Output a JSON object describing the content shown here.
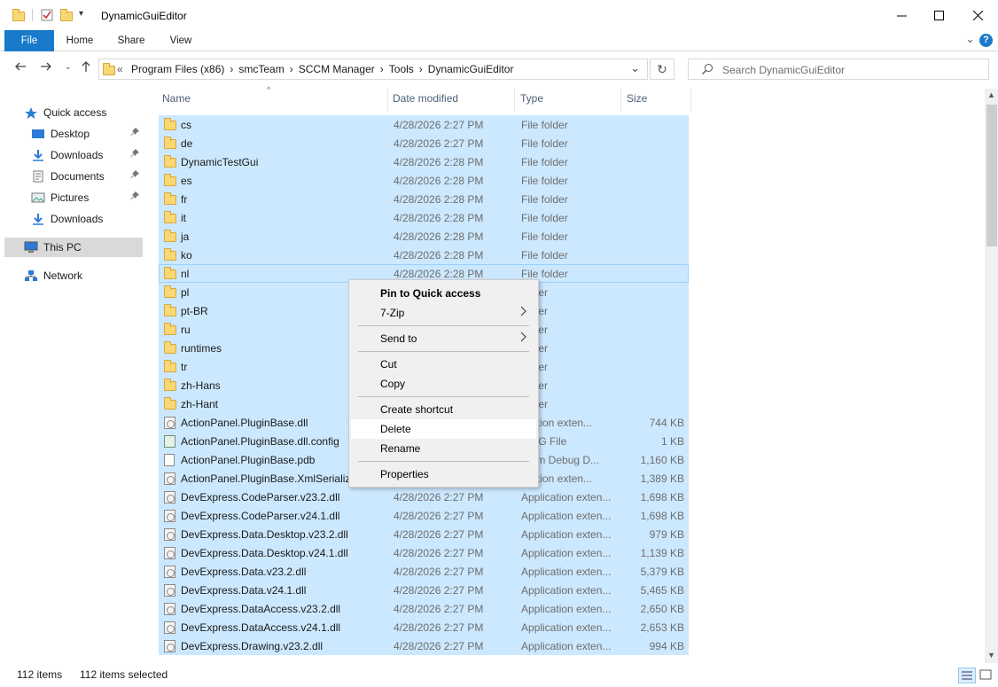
{
  "window": {
    "title": "DynamicGuiEditor",
    "minimize_icon": "minimize-icon",
    "maximize_icon": "maximize-icon",
    "close_icon": "close-icon"
  },
  "ribbon": {
    "tabs": [
      "File",
      "Home",
      "Share",
      "View"
    ],
    "expand_glyph": "⌄",
    "help_glyph": "?"
  },
  "address": {
    "overflow": "«",
    "crumbs": [
      "Program Files (x86)",
      "smcTeam",
      "SCCM Manager",
      "Tools",
      "DynamicGuiEditor"
    ]
  },
  "search": {
    "placeholder": "Search DynamicGuiEditor"
  },
  "nav": {
    "items": [
      {
        "label": "Quick access",
        "icon": "star-icon"
      },
      {
        "label": "Desktop",
        "icon": "desktop-icon",
        "pinned": true
      },
      {
        "label": "Downloads",
        "icon": "download-icon",
        "pinned": true
      },
      {
        "label": "Documents",
        "icon": "documents-icon",
        "pinned": true
      },
      {
        "label": "Pictures",
        "icon": "pictures-icon",
        "pinned": true
      },
      {
        "label": "Downloads",
        "icon": "download-icon",
        "pinned": false
      },
      {
        "label": "This PC",
        "icon": "computer-icon"
      },
      {
        "label": "Network",
        "icon": "network-icon"
      }
    ]
  },
  "columns": {
    "name": "Name",
    "date": "Date modified",
    "type": "Type",
    "size": "Size"
  },
  "files": [
    {
      "name": "cs",
      "date": "4/28/2026 2:27 PM",
      "type": "File folder",
      "size": "",
      "icon": "folder"
    },
    {
      "name": "de",
      "date": "4/28/2026 2:27 PM",
      "type": "File folder",
      "size": "",
      "icon": "folder"
    },
    {
      "name": "DynamicTestGui",
      "date": "4/28/2026 2:28 PM",
      "type": "File folder",
      "size": "",
      "icon": "folder"
    },
    {
      "name": "es",
      "date": "4/28/2026 2:28 PM",
      "type": "File folder",
      "size": "",
      "icon": "folder"
    },
    {
      "name": "fr",
      "date": "4/28/2026 2:28 PM",
      "type": "File folder",
      "size": "",
      "icon": "folder"
    },
    {
      "name": "it",
      "date": "4/28/2026 2:28 PM",
      "type": "File folder",
      "size": "",
      "icon": "folder"
    },
    {
      "name": "ja",
      "date": "4/28/2026 2:28 PM",
      "type": "File folder",
      "size": "",
      "icon": "folder"
    },
    {
      "name": "ko",
      "date": "4/28/2026 2:28 PM",
      "type": "File folder",
      "size": "",
      "icon": "folder"
    },
    {
      "name": "nl",
      "date": "4/28/2026 2:28 PM",
      "type": "File folder",
      "size": "",
      "icon": "folder"
    },
    {
      "name": "pl",
      "date": "",
      "type": "folder",
      "size": "",
      "icon": "folder"
    },
    {
      "name": "pt-BR",
      "date": "",
      "type": "folder",
      "size": "",
      "icon": "folder"
    },
    {
      "name": "ru",
      "date": "",
      "type": "folder",
      "size": "",
      "icon": "folder"
    },
    {
      "name": "runtimes",
      "date": "",
      "type": "folder",
      "size": "",
      "icon": "folder"
    },
    {
      "name": "tr",
      "date": "",
      "type": "folder",
      "size": "",
      "icon": "folder"
    },
    {
      "name": "zh-Hans",
      "date": "",
      "type": "folder",
      "size": "",
      "icon": "folder"
    },
    {
      "name": "zh-Hant",
      "date": "",
      "type": "folder",
      "size": "",
      "icon": "folder"
    },
    {
      "name": "ActionPanel.PluginBase.dll",
      "date": "",
      "type": "lication exten...",
      "size": "744 KB",
      "icon": "dll"
    },
    {
      "name": "ActionPanel.PluginBase.dll.config",
      "date": "",
      "type": "NFIG File",
      "size": "1 KB",
      "icon": "config"
    },
    {
      "name": "ActionPanel.PluginBase.pdb",
      "date": "",
      "type": "gram Debug D...",
      "size": "1,160 KB",
      "icon": "file"
    },
    {
      "name": "ActionPanel.PluginBase.XmlSerialize",
      "date": "",
      "type": "lication exten...",
      "size": "1,389 KB",
      "icon": "dll"
    },
    {
      "name": "DevExpress.CodeParser.v23.2.dll",
      "date": "4/28/2026 2:27 PM",
      "type": "Application exten...",
      "size": "1,698 KB",
      "icon": "dll"
    },
    {
      "name": "DevExpress.CodeParser.v24.1.dll",
      "date": "4/28/2026 2:27 PM",
      "type": "Application exten...",
      "size": "1,698 KB",
      "icon": "dll"
    },
    {
      "name": "DevExpress.Data.Desktop.v23.2.dll",
      "date": "4/28/2026 2:27 PM",
      "type": "Application exten...",
      "size": "979 KB",
      "icon": "dll"
    },
    {
      "name": "DevExpress.Data.Desktop.v24.1.dll",
      "date": "4/28/2026 2:27 PM",
      "type": "Application exten...",
      "size": "1,139 KB",
      "icon": "dll"
    },
    {
      "name": "DevExpress.Data.v23.2.dll",
      "date": "4/28/2026 2:27 PM",
      "type": "Application exten...",
      "size": "5,379 KB",
      "icon": "dll"
    },
    {
      "name": "DevExpress.Data.v24.1.dll",
      "date": "4/28/2026 2:27 PM",
      "type": "Application exten...",
      "size": "5,465 KB",
      "icon": "dll"
    },
    {
      "name": "DevExpress.DataAccess.v23.2.dll",
      "date": "4/28/2026 2:27 PM",
      "type": "Application exten...",
      "size": "2,650 KB",
      "icon": "dll"
    },
    {
      "name": "DevExpress.DataAccess.v24.1.dll",
      "date": "4/28/2026 2:27 PM",
      "type": "Application exten...",
      "size": "2,653 KB",
      "icon": "dll"
    },
    {
      "name": "DevExpress.Drawing.v23.2.dll",
      "date": "4/28/2026 2:27 PM",
      "type": "Application exten...",
      "size": "994 KB",
      "icon": "dll"
    }
  ],
  "context_menu": {
    "items": [
      {
        "label": "Pin to Quick access",
        "bold": true,
        "submenu": false
      },
      {
        "label": "7-Zip",
        "submenu": true
      },
      {
        "sep": true
      },
      {
        "label": "Send to",
        "submenu": true
      },
      {
        "sep": true
      },
      {
        "label": "Cut"
      },
      {
        "label": "Copy"
      },
      {
        "sep": true
      },
      {
        "label": "Create shortcut"
      },
      {
        "label": "Delete",
        "hover": true
      },
      {
        "label": "Rename"
      },
      {
        "sep": true
      },
      {
        "label": "Properties"
      }
    ]
  },
  "status": {
    "count": "112 items",
    "selected": "112 items selected"
  },
  "colors": {
    "selection": "#cce8ff",
    "accent": "#1979ca",
    "folder": "#f8d775"
  }
}
